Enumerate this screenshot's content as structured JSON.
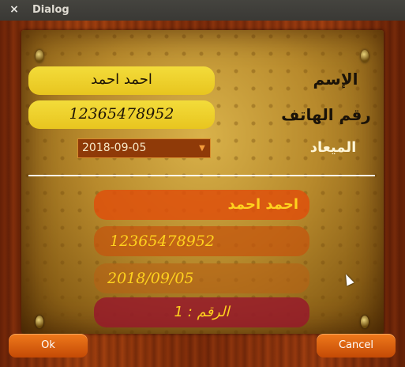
{
  "window": {
    "title": "Dialog",
    "close_icon": "×"
  },
  "form": {
    "name_label": "الإسم",
    "name_value": "احمد احمد",
    "phone_label": "رقم الهاتف",
    "phone_value": "12365478952",
    "date_label": "الميعاد",
    "date_value": "2018-09-05"
  },
  "results": {
    "name": "احمد احمد",
    "phone": "12365478952",
    "date": "2018/09/05",
    "number": "الرقم : 1"
  },
  "buttons": {
    "ok": "Ok",
    "cancel": "Cancel"
  },
  "colors": {
    "accent_orange": "#e05a0a",
    "pill_yellow": "#f0d32c",
    "result_text": "#ffd21e",
    "date_bg": "#8f3a08"
  }
}
